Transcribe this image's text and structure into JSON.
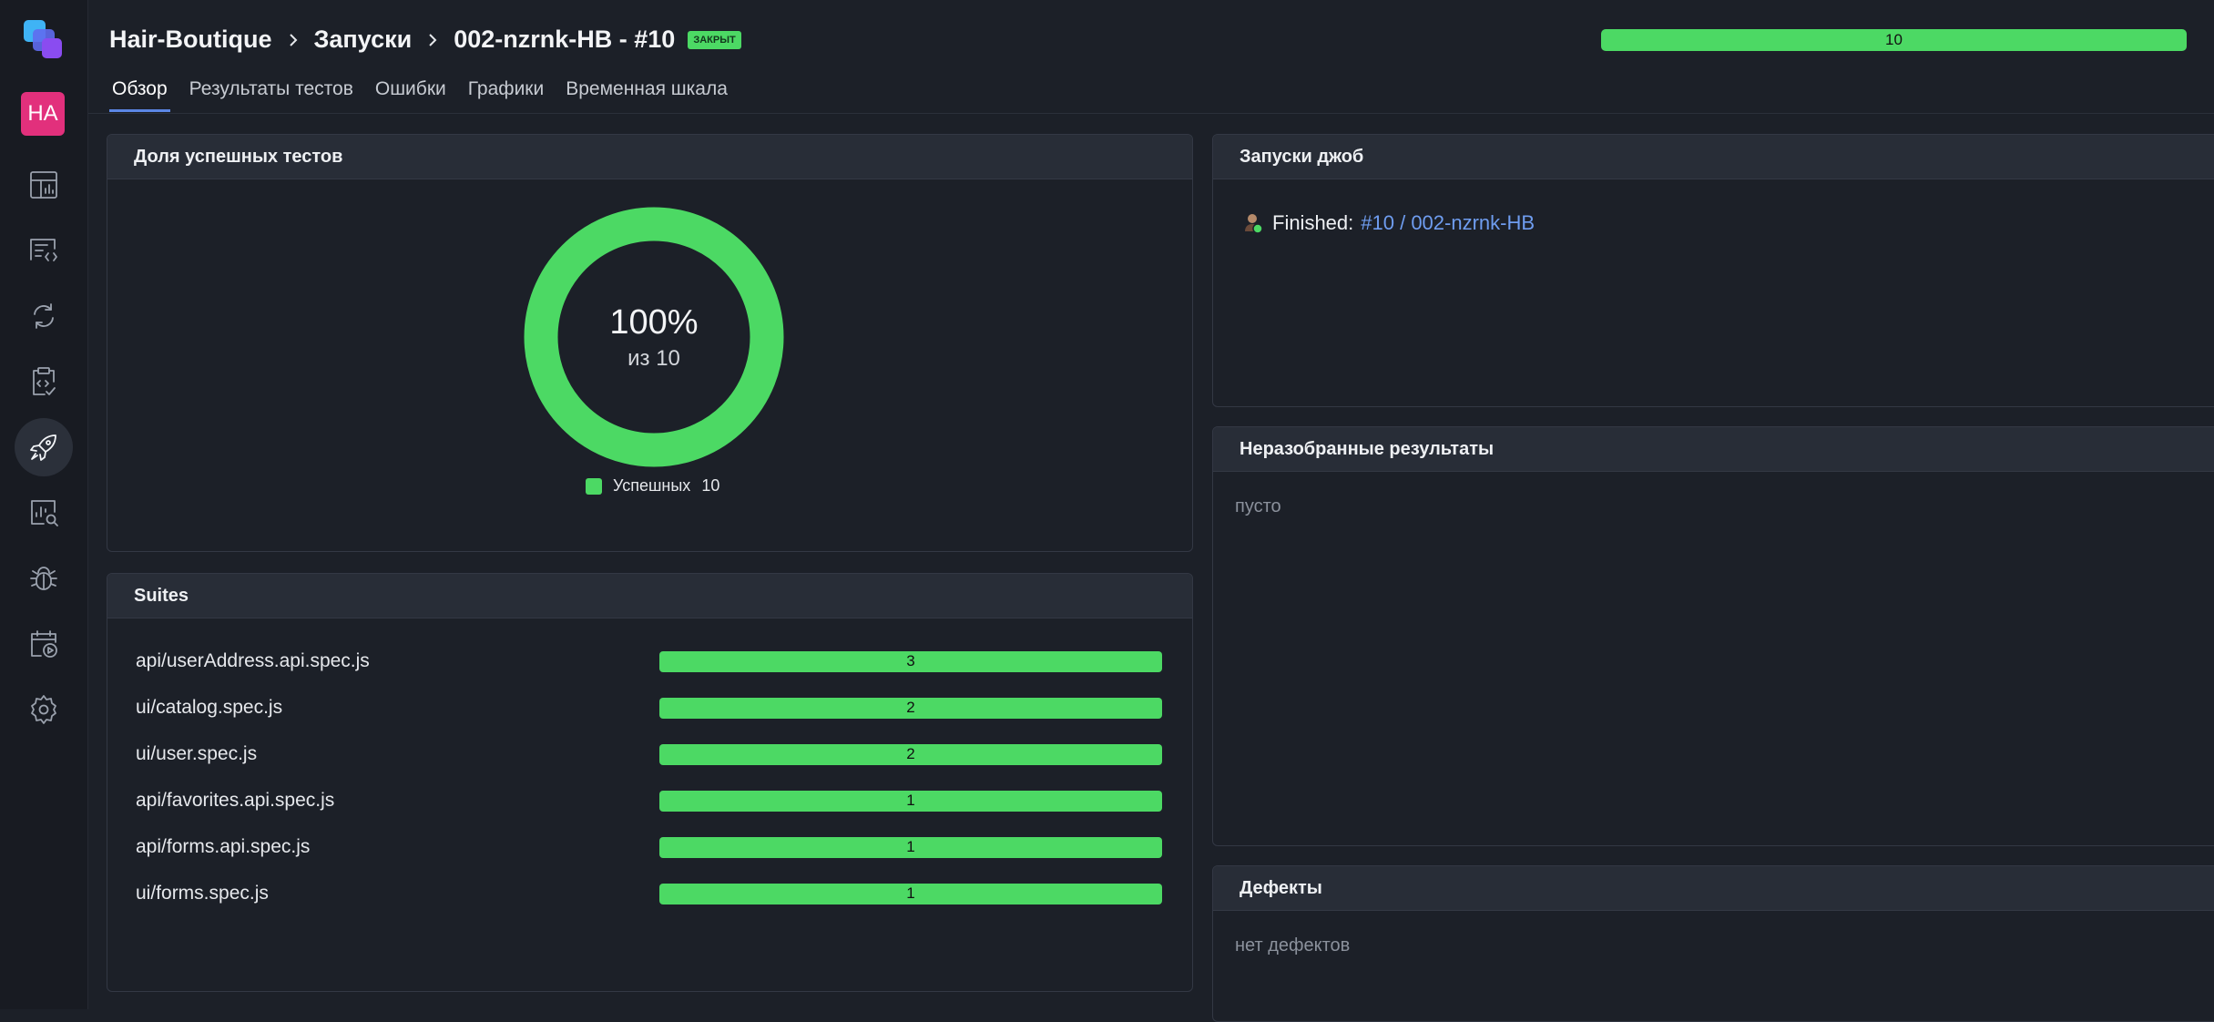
{
  "user": {
    "initials": "HA"
  },
  "breadcrumbs": [
    "Hair-Boutique",
    "Запуски",
    "002-nzrnk-HB - #10"
  ],
  "status_badge": "ЗАКРЫТ",
  "top_progress": {
    "label": "10",
    "fraction": 1.0
  },
  "tabs": [
    {
      "label": "Обзор",
      "active": true
    },
    {
      "label": "Результаты тестов",
      "active": false
    },
    {
      "label": "Ошибки",
      "active": false
    },
    {
      "label": "Графики",
      "active": false
    },
    {
      "label": "Временная шкала",
      "active": false
    }
  ],
  "success_panel": {
    "title": "Доля успешных тестов",
    "percent": "100%",
    "subtitle": "из 10",
    "legend_label": "Успешных",
    "legend_value": "10"
  },
  "suites_panel": {
    "title": "Suites",
    "rows": [
      {
        "name": "api/userAddress.api.spec.js",
        "count": "3"
      },
      {
        "name": "ui/catalog.spec.js",
        "count": "2"
      },
      {
        "name": "ui/user.spec.js",
        "count": "2"
      },
      {
        "name": "api/favorites.api.spec.js",
        "count": "1"
      },
      {
        "name": "api/forms.api.spec.js",
        "count": "1"
      },
      {
        "name": "ui/forms.spec.js",
        "count": "1"
      }
    ]
  },
  "jobs_panel": {
    "title": "Запуски джоб",
    "status_text": "Finished:",
    "link_text": "#10 / 002-nzrnk-HB"
  },
  "unreviewed_panel": {
    "title": "Неразобранные результаты",
    "empty_text": "пусто"
  },
  "defects_panel": {
    "title": "Дефекты",
    "empty_text": "нет дефектов"
  },
  "colors": {
    "success": "#4cd964",
    "accent": "#5b86e5",
    "avatar": "#e2307c",
    "link": "#6f9df0"
  },
  "nav_icons": [
    "dashboard-icon",
    "code-list-icon",
    "sync-icon",
    "clipboard-check-icon",
    "rocket-icon",
    "chart-search-icon",
    "bug-icon",
    "calendar-play-icon",
    "gear-icon"
  ]
}
